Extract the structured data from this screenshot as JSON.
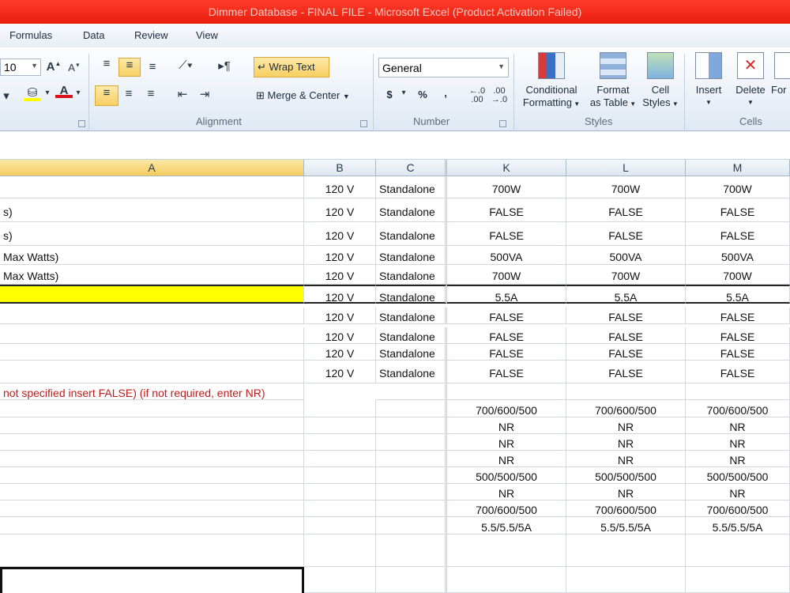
{
  "window": {
    "title": "Dimmer Database - FINAL FILE  -  Microsoft Excel (Product Activation Failed)"
  },
  "menu": {
    "tabs": [
      "Formulas",
      "Data",
      "Review",
      "View"
    ]
  },
  "ribbon": {
    "font_size": "10",
    "wrap_text": "Wrap Text",
    "merge_center": "Merge & Center",
    "number_format": "General",
    "currency": "$",
    "percent": "%",
    "comma": ",",
    "conditional_formatting": [
      "Conditional",
      "Formatting"
    ],
    "format_as_table": [
      "Format",
      "as Table"
    ],
    "cell_styles": [
      "Cell",
      "Styles"
    ],
    "insert": "Insert",
    "delete": "Delete",
    "format": "For",
    "groups": {
      "alignment": "Alignment",
      "number": "Number",
      "styles": "Styles",
      "cells": "Cells"
    }
  },
  "sheet": {
    "columns": [
      "A",
      "B",
      "C",
      "K",
      "L",
      "M"
    ],
    "rows": [
      {
        "a": "",
        "b": "120 V",
        "c": "Standalone",
        "k": "700W",
        "l": "700W",
        "m": "700W"
      },
      {
        "a": "s)",
        "b": "120 V",
        "c": "Standalone",
        "k": "FALSE",
        "l": "FALSE",
        "m": "FALSE"
      },
      {
        "a": "s)",
        "b": "120 V",
        "c": "Standalone",
        "k": "FALSE",
        "l": "FALSE",
        "m": "FALSE"
      },
      {
        "a": "Max Watts)",
        "b": "120 V",
        "c": "Standalone",
        "k": "500VA",
        "l": "500VA",
        "m": "500VA"
      },
      {
        "a": "Max Watts)",
        "b": "120 V",
        "c": "Standalone",
        "k": "700W",
        "l": "700W",
        "m": "700W"
      },
      {
        "a": "",
        "b": "120 V",
        "c": "Standalone",
        "k": "5.5A",
        "l": "5.5A",
        "m": "5.5A"
      },
      {
        "a": "",
        "b": "120 V",
        "c": "Standalone",
        "k": "FALSE",
        "l": "FALSE",
        "m": "FALSE"
      },
      {
        "a": "",
        "b": "120 V",
        "c": "Standalone",
        "k": "FALSE",
        "l": "FALSE",
        "m": "FALSE"
      },
      {
        "a": "",
        "b": "120 V",
        "c": "Standalone",
        "k": "FALSE",
        "l": "FALSE",
        "m": "FALSE"
      },
      {
        "a": "",
        "b": "120 V",
        "c": "Standalone",
        "k": "FALSE",
        "l": "FALSE",
        "m": "FALSE"
      },
      {
        "a": "not specified insert FALSE) (if not required, enter NR)",
        "b": "",
        "c": "",
        "k": "",
        "l": "",
        "m": ""
      },
      {
        "a": "",
        "b": "",
        "c": "",
        "k": "700/600/500",
        "l": "700/600/500",
        "m": "700/600/500"
      },
      {
        "a": "",
        "b": "",
        "c": "",
        "k": "NR",
        "l": "NR",
        "m": "NR"
      },
      {
        "a": "",
        "b": "",
        "c": "",
        "k": "NR",
        "l": "NR",
        "m": "NR"
      },
      {
        "a": "",
        "b": "",
        "c": "",
        "k": "NR",
        "l": "NR",
        "m": "NR"
      },
      {
        "a": "",
        "b": "",
        "c": "",
        "k": "500/500/500",
        "l": "500/500/500",
        "m": "500/500/500"
      },
      {
        "a": "",
        "b": "",
        "c": "",
        "k": "NR",
        "l": "NR",
        "m": "NR"
      },
      {
        "a": "",
        "b": "",
        "c": "",
        "k": "700/600/500",
        "l": "700/600/500",
        "m": "700/600/500"
      },
      {
        "a": "",
        "b": "",
        "c": "",
        "k": "5.5/5.5/5A",
        "l": "5.5/5.5/5A",
        "m": "5.5/5.5/5A"
      },
      {
        "a": "",
        "b": "",
        "c": "",
        "k": "",
        "l": "",
        "m": ""
      },
      {
        "a": "",
        "b": "",
        "c": "",
        "k": "",
        "l": "",
        "m": ""
      }
    ],
    "colors": {
      "highlight": "#ffff00",
      "note_text": "#c21a1a",
      "active_header": "#f4cb5d"
    }
  }
}
